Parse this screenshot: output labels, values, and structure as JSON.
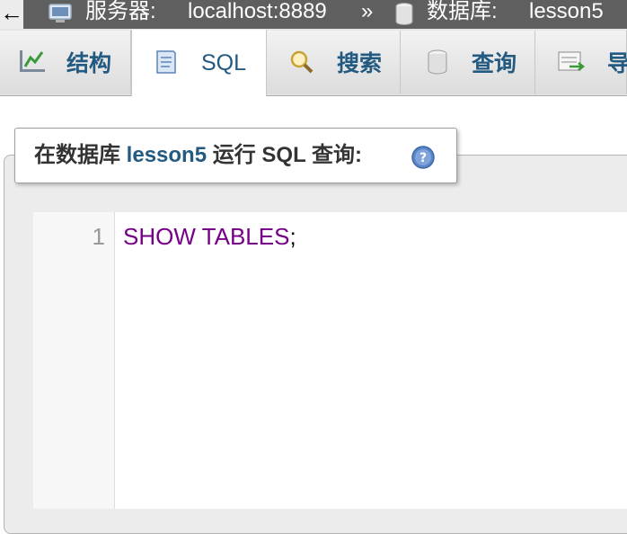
{
  "breadcrumb": {
    "back_glyph": "←",
    "server_label": "服务器:",
    "server_value": "localhost:8889",
    "separator": "»",
    "database_label": "数据库:",
    "database_value": "lesson5"
  },
  "tabs": [
    {
      "label": "结构",
      "icon": "structure-icon",
      "active": false
    },
    {
      "label": "SQL",
      "icon": "sql-document-icon",
      "active": true
    },
    {
      "label": "搜索",
      "icon": "magnifier-icon",
      "active": false
    },
    {
      "label": "查询",
      "icon": "database-cylinder-icon",
      "active": false
    },
    {
      "label": "导",
      "icon": "export-icon",
      "active": false
    }
  ],
  "query_panel": {
    "legend_prefix": "在数据库",
    "legend_database": "lesson5",
    "legend_suffix": "运行 SQL 查询:",
    "help_icon": "help-icon"
  },
  "editor": {
    "line_number": "1",
    "keyword_show": "SHOW",
    "keyword_tables": "TABLES",
    "terminator": ";"
  },
  "colors": {
    "link_blue": "#235a81",
    "sql_keyword": "#770088",
    "breadcrumb_bg": "#5f5f5f"
  }
}
